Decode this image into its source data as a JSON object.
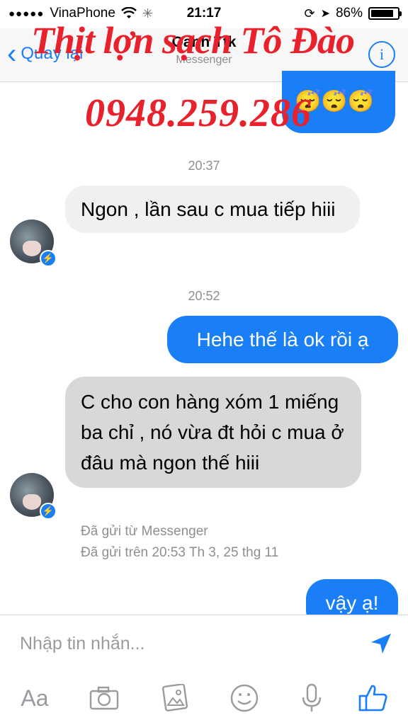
{
  "status": {
    "carrier": "VinaPhone",
    "time": "21:17",
    "battery": "86%",
    "battery_level": 0.86
  },
  "nav": {
    "back_label": "Quay lại",
    "title": "Oanh Ttk",
    "subtitle": "Messenger",
    "info_label": "i"
  },
  "watermark": {
    "line1": "Thịt lợn sạch Tô Đào",
    "line2": "0948.259.286"
  },
  "messages": {
    "top_emojis": "😴😴😴",
    "time1": "20:37",
    "msg1": "Ngon , lần sau c mua tiếp hiii",
    "time2": "20:52",
    "msg2": "Hehe thế là ok rồi ạ",
    "msg3": "C cho con hàng xóm 1 miếng ba chỉ , nó vừa đt hỏi c mua ở đâu mà ngon thế hiii",
    "meta1": "Đã gửi từ Messenger",
    "meta2": "Đã gửi trên 20:53 Th 3, 25 thg 11",
    "msg4": "vậy ạ!"
  },
  "composer": {
    "placeholder": "Nhập tin nhắn...",
    "aa_label": "Aa"
  },
  "colors": {
    "accent": "#1a7ff7",
    "incoming": "#f1f0f0",
    "watermark": "#e8212c"
  }
}
